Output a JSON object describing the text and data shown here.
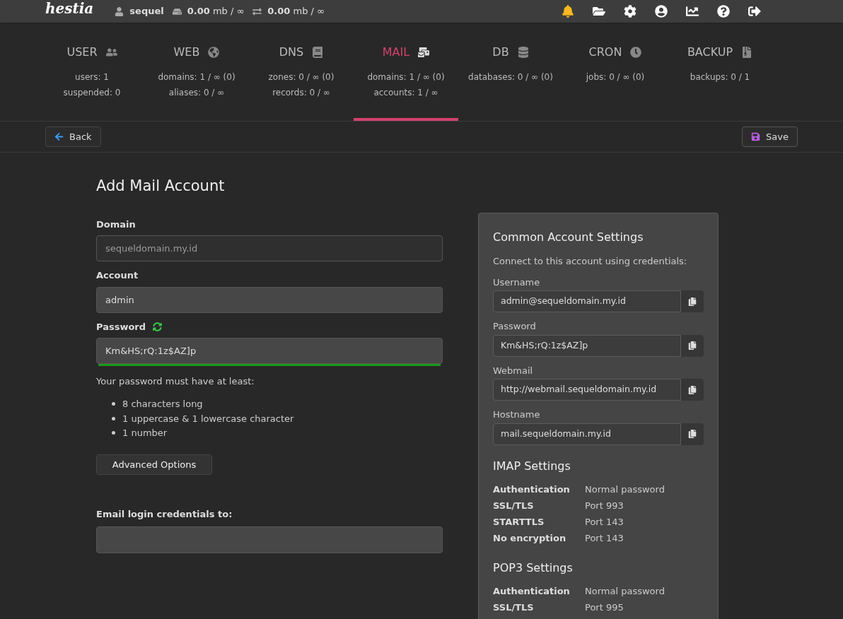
{
  "topbar": {
    "logo": "hestia",
    "user": "sequel",
    "disk": "**0.00** mb / ∞",
    "bandwidth": "**0.00** mb / ∞",
    "notifications": {
      "unread": true
    }
  },
  "tabs": [
    {
      "label": "USER",
      "stats": [
        "users: 1",
        "suspended: 0"
      ],
      "selected": false
    },
    {
      "label": "WEB",
      "stats": [
        "domains: 1 / ∞ (0)",
        "aliases: 0 / ∞"
      ],
      "selected": false
    },
    {
      "label": "DNS",
      "stats": [
        "zones: 0 / ∞ (0)",
        "records: 0 / ∞"
      ],
      "selected": false
    },
    {
      "label": "MAIL",
      "stats": [
        "domains: 1 / ∞ (0)",
        "accounts: 1 / ∞"
      ],
      "selected": true
    },
    {
      "label": "DB",
      "stats": [
        "databases: 0 / ∞ (0)"
      ],
      "selected": false
    },
    {
      "label": "CRON",
      "stats": [
        "jobs: 0 / ∞ (0)"
      ],
      "selected": false
    },
    {
      "label": "BACKUP",
      "stats": [
        "backups: 0 / 1"
      ],
      "selected": false
    }
  ],
  "toolbar": {
    "back": "Back",
    "save": "Save"
  },
  "form": {
    "title": "Add Mail Account",
    "domain": {
      "label": "Domain",
      "value": "sequeldomain.my.id",
      "disabled": true
    },
    "account": {
      "label": "Account",
      "value": "admin"
    },
    "password": {
      "label": "Password",
      "value": "Km&HS;rQ:1z$AZ]p",
      "level": 1
    },
    "requirements_intro": "Your password must have at least:",
    "requirements": [
      "8 characters long",
      "1 uppercase & 1 lowercase character",
      "1 number"
    ],
    "advanced": "Advanced Options",
    "email_to": {
      "label": "Email login credentials to:"
    }
  },
  "panel": {
    "title": "Common Account Settings",
    "intro": "Connect to this account using credentials:",
    "fields": [
      {
        "label": "Username",
        "value": "admin@sequeldomain.my.id"
      },
      {
        "label": "Password",
        "value": "Km&HS;rQ:1z$AZ]p"
      },
      {
        "label": "Webmail",
        "value": "http://webmail.sequeldomain.my.id"
      },
      {
        "label": "Hostname",
        "value": "mail.sequeldomain.my.id"
      }
    ],
    "sections": [
      {
        "title": "IMAP Settings",
        "rows": [
          {
            "name": "Authentication",
            "value": "Normal password"
          },
          {
            "name": "SSL/TLS",
            "value": "Port 993"
          },
          {
            "name": "STARTTLS",
            "value": "Port 143"
          },
          {
            "name": "No encryption",
            "value": "Port 143"
          }
        ]
      },
      {
        "title": "POP3 Settings",
        "rows": [
          {
            "name": "Authentication",
            "value": "Normal password"
          },
          {
            "name": "SSL/TLS",
            "value": "Port 995"
          }
        ]
      }
    ]
  }
}
